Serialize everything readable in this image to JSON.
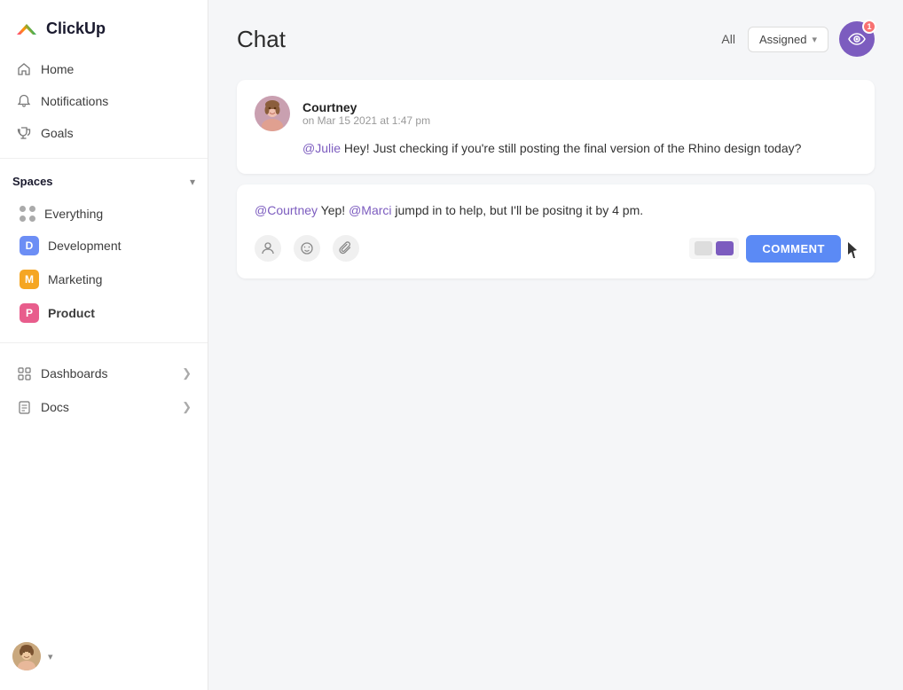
{
  "app": {
    "name": "ClickUp"
  },
  "sidebar": {
    "nav": [
      {
        "id": "home",
        "label": "Home",
        "icon": "home-icon"
      },
      {
        "id": "notifications",
        "label": "Notifications",
        "icon": "bell-icon"
      },
      {
        "id": "goals",
        "label": "Goals",
        "icon": "trophy-icon"
      }
    ],
    "spaces_label": "Spaces",
    "spaces": [
      {
        "id": "everything",
        "label": "Everything",
        "icon": "dots-icon",
        "color": ""
      },
      {
        "id": "development",
        "label": "Development",
        "icon": "d-icon",
        "color": "#6c8ef5",
        "letter": "D"
      },
      {
        "id": "marketing",
        "label": "Marketing",
        "icon": "m-icon",
        "color": "#f5a623",
        "letter": "M"
      },
      {
        "id": "product",
        "label": "Product",
        "icon": "p-icon",
        "color": "#e85d8c",
        "letter": "P",
        "active": true
      }
    ],
    "bottom_items": [
      {
        "id": "dashboards",
        "label": "Dashboards"
      },
      {
        "id": "docs",
        "label": "Docs"
      }
    ]
  },
  "chat": {
    "title": "Chat",
    "filter_all": "All",
    "filter_assigned": "Assigned",
    "notification_count": "1",
    "messages": [
      {
        "id": "msg1",
        "author": "Courtney",
        "time": "on Mar 15 2021 at 1:47 pm",
        "mention": "@Julie",
        "body": " Hey! Just checking if you're still posting the final version of the Rhino design today?"
      }
    ],
    "reply": {
      "mention1": "@Courtney",
      "text1": " Yep! ",
      "mention2": "@Marci",
      "text2": " jumpd in to help, but I'll be positng it by 4 pm."
    },
    "comment_button": "COMMENT"
  }
}
